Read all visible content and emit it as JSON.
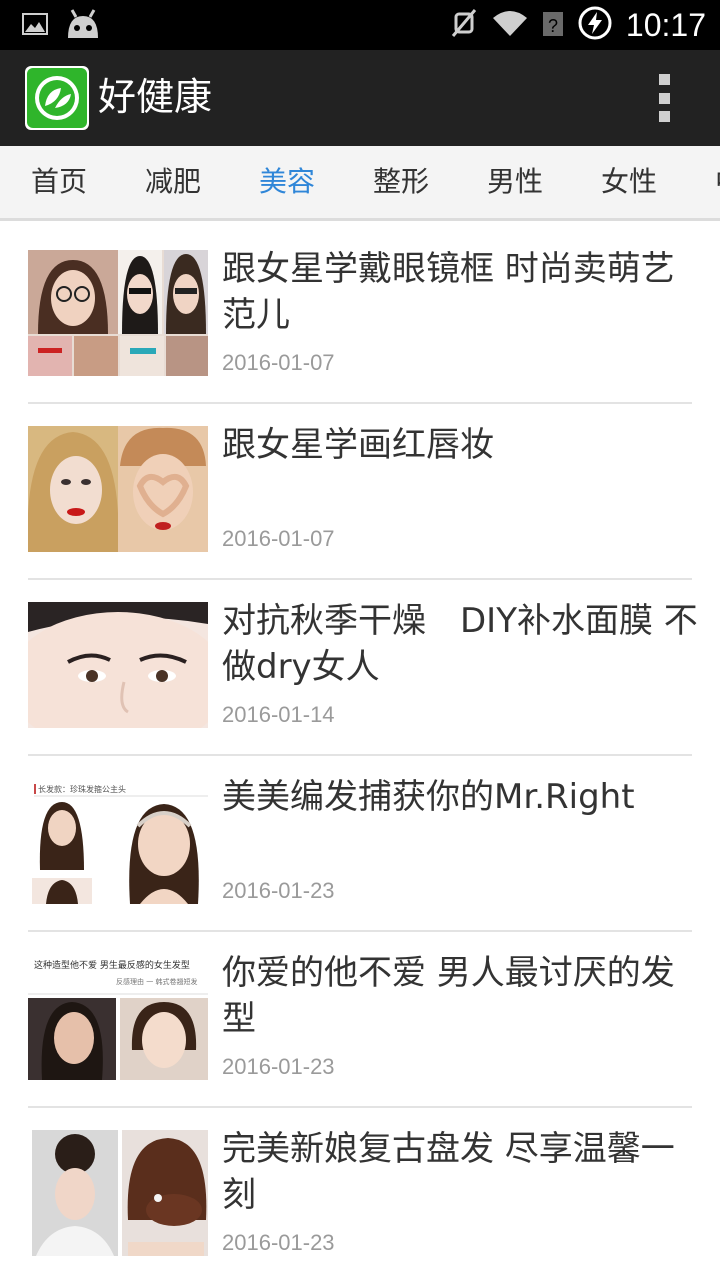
{
  "status_bar": {
    "time": "10:17",
    "icons": [
      "image-icon",
      "android-icon",
      "mute-icon",
      "wifi-icon",
      "no-signal-icon",
      "battery-charging-icon"
    ]
  },
  "app_bar": {
    "title": "好健康",
    "logo_icon": "leaf-logo-icon",
    "overflow_icon": "more-vert-icon"
  },
  "tabs": [
    {
      "label": "首页"
    },
    {
      "label": "减肥"
    },
    {
      "label": "美容"
    },
    {
      "label": "整形"
    },
    {
      "label": "男性"
    },
    {
      "label": "女性"
    },
    {
      "label": "中"
    }
  ],
  "active_tab": "美容",
  "colors": {
    "accent": "#2f86d8",
    "app_bar": "#222222",
    "logo_green": "#2fb52b"
  },
  "articles": [
    {
      "title": "跟女星学戴眼镜框 时尚卖萌艺范儿",
      "date": "2016-01-07"
    },
    {
      "title": "跟女星学画红唇妆",
      "date": "2016-01-07"
    },
    {
      "title": "对抗秋季干燥　DIY补水面膜 不做dry女人",
      "date": "2016-01-14"
    },
    {
      "title": "美美编发捕获你的Mr.Right",
      "date": "2016-01-23"
    },
    {
      "title": "你爱的他不爱 男人最讨厌的发型",
      "date": "2016-01-23"
    },
    {
      "title": "完美新娘复古盘发 尽享温馨一刻",
      "date": "2016-01-23"
    }
  ],
  "thumb_captions": {
    "item3": "长发款：珍珠发箍公主头",
    "item4": "这种造型他不爱 男生最反感的女生发型",
    "item4_sub": "反感理由 一 韩式卷翘短发"
  }
}
